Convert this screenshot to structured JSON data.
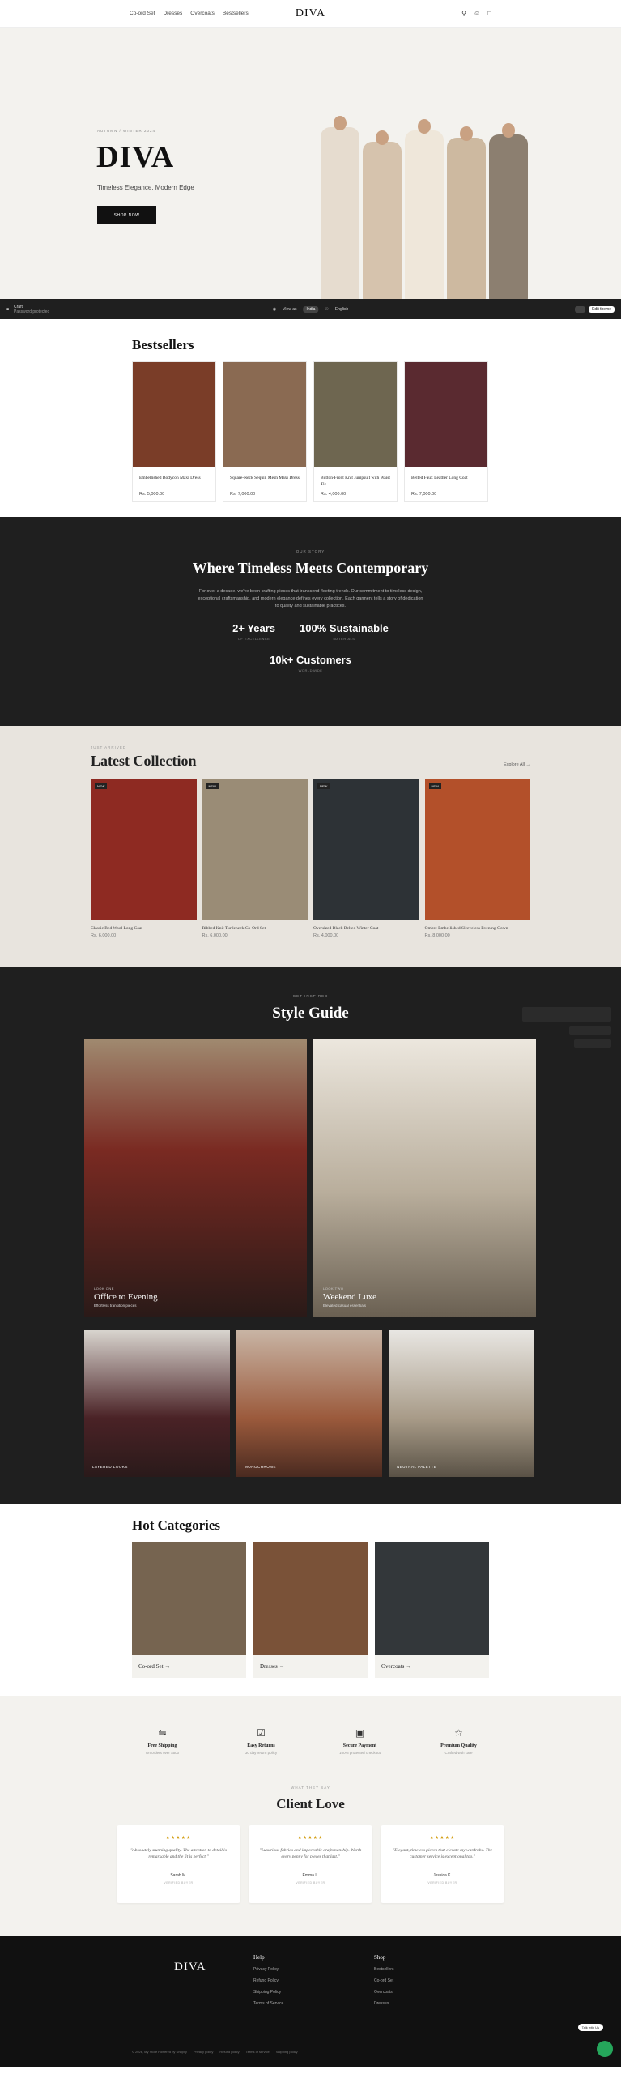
{
  "header": {
    "nav": [
      "Co-ord Set",
      "Dresses",
      "Overcoats",
      "Bestsellers"
    ],
    "logo": "DIVA",
    "icons": [
      "search-icon",
      "account-icon",
      "cart-icon"
    ]
  },
  "hero": {
    "eyebrow": "AUTUMN / WINTER 2024",
    "title": "DIVA",
    "subtitle": "Timeless Elegance, Modern Edge",
    "cta": "SHOP NOW"
  },
  "shopify_bar": {
    "store_name": "Craft",
    "store_status": "Password protected",
    "view_as_label": "View as",
    "country": "India",
    "language": "English",
    "edit_label": "Edit theme"
  },
  "bestsellers": {
    "title": "Bestsellers",
    "products": [
      {
        "name": "Embellished Bodycon Maxi Dress",
        "price": "Rs. 5,000.00",
        "color": "#7a3d28"
      },
      {
        "name": "Square-Neck Sequin Mesh Maxi Dress",
        "price": "Rs. 7,000.00",
        "color": "#8a6a52"
      },
      {
        "name": "Button-Front Knit Jumpsuit with Waist Tie",
        "price": "Rs. 4,000.00",
        "color": "#6e6650"
      },
      {
        "name": "Belted Faux Leather Long Coat",
        "price": "Rs. 7,000.00",
        "color": "#5a2a30"
      }
    ]
  },
  "story": {
    "eyebrow": "OUR STORY",
    "title": "Where Timeless Meets Contemporary",
    "body": "For over a decade, we've been crafting pieces that transcend fleeting trends. Our commitment to timeless design, exceptional craftsmanship, and modern elegance defines every collection. Each garment tells a story of dedication to quality and sustainable practices.",
    "stats": [
      {
        "value": "2+ Years",
        "label": "OF EXCELLENCE"
      },
      {
        "value": "100% Sustainable",
        "label": "MATERIALS"
      },
      {
        "value": "10k+ Customers",
        "label": "WORLDWIDE"
      }
    ]
  },
  "latest": {
    "eyebrow": "JUST ARRIVED",
    "title": "Latest Collection",
    "explore": "Explore All →",
    "badge": "NEW",
    "products": [
      {
        "name": "Classic Red Wool Long Coat",
        "price": "Rs. 6,000.00",
        "color": "#8e2a22"
      },
      {
        "name": "Ribbed Knit Turtleneck Co-Ord Set",
        "price": "Rs. 6,000.00",
        "color": "#9a8c76"
      },
      {
        "name": "Oversized Black Belted Winter Coat",
        "price": "Rs. 4,000.00",
        "color": "#2d3236"
      },
      {
        "name": "Ombre Embellished Sleeveless Evening Gown",
        "price": "Rs. 8,000.00",
        "color": "#b3502a"
      }
    ]
  },
  "guide": {
    "eyebrow": "GET INSPIRED",
    "title": "Style Guide",
    "big": [
      {
        "kicker": "LOOK ONE",
        "title": "Office to Evening",
        "desc": "Effortless transition pieces",
        "color": "#7a2a22"
      },
      {
        "kicker": "LOOK TWO",
        "title": "Weekend Luxe",
        "desc": "Elevated casual essentials",
        "color": "#b9ae9c"
      }
    ],
    "small": [
      {
        "label": "LAYERED LOOKS",
        "color": "#4a2226"
      },
      {
        "label": "MONOCHROME",
        "color": "#9b5a3c"
      },
      {
        "label": "NEUTRAL PALETTE",
        "color": "#a89b88"
      }
    ]
  },
  "hot": {
    "title": "Hot Categories",
    "items": [
      {
        "label": "Co-ord Set →",
        "color": "#766450"
      },
      {
        "label": "Dresses →",
        "color": "#7a5238"
      },
      {
        "label": "Overcoats →",
        "color": "#33373a"
      }
    ]
  },
  "features": [
    {
      "icon": "truck-icon",
      "title": "Free Shipping",
      "desc": "On orders over $500"
    },
    {
      "icon": "check-icon",
      "title": "Easy Returns",
      "desc": "30 day return policy"
    },
    {
      "icon": "lock-icon",
      "title": "Secure Payment",
      "desc": "100% protected checkout"
    },
    {
      "icon": "star-icon",
      "title": "Premium Quality",
      "desc": "Crafted with care"
    }
  ],
  "love": {
    "eyebrow": "WHAT THEY SAY",
    "title": "Client Love",
    "stars": "★★★★★",
    "reviews": [
      {
        "quote": "\"Absolutely stunning quality. The attention to detail is remarkable and the fit is perfect.\"",
        "name": "Sarah M.",
        "tag": "VERIFIED BUYER"
      },
      {
        "quote": "\"Luxurious fabrics and impeccable craftsmanship. Worth every penny for pieces that last.\"",
        "name": "Emma L.",
        "tag": "VERIFIED BUYER"
      },
      {
        "quote": "\"Elegant, timeless pieces that elevate my wardrobe. The customer service is exceptional too.\"",
        "name": "Jessica K.",
        "tag": "VERIFIED BUYER"
      }
    ]
  },
  "footer": {
    "logo": "DIVA",
    "help_title": "Help",
    "help_links": [
      "Privacy Policy",
      "Refund Policy",
      "Shipping Policy",
      "Terms of Service"
    ],
    "shop_title": "Shop",
    "shop_links": [
      "Bestsellers",
      "Co-ord Set",
      "Overcoats",
      "Dresses"
    ],
    "bottom": [
      "© 2026, My Store Powered by Shopify",
      "Privacy policy",
      "Refund policy",
      "Terms of service",
      "Shipping policy"
    ],
    "help_pill": "Talk with Us"
  },
  "colors": {
    "hero_bg": "#f3f2ee",
    "dark": "#1f1f1f",
    "latest_bg": "#e8e4de",
    "star": "#d4a017",
    "chat": "#25a65b"
  }
}
